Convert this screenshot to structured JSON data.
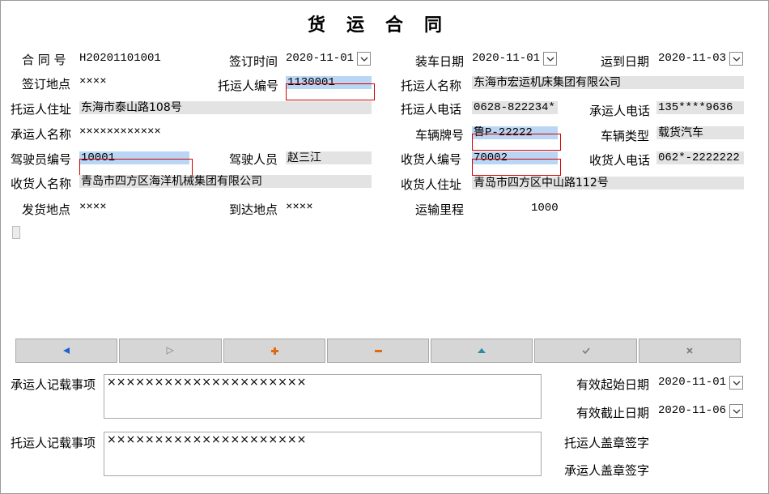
{
  "title": "货运合同",
  "colors": {
    "selection": "#b9d6f5",
    "field_bg": "#e3e3e3",
    "error_border": "#d40000",
    "nav_bg": "#d6d6d6"
  },
  "fields": {
    "contract_no_label": "合 同 号",
    "contract_no": "H20201101001",
    "sign_time_label": "签订时间",
    "sign_time": "2020-11-01",
    "load_date_label": "装车日期",
    "load_date": "2020-11-01",
    "arrive_date_label": "运到日期",
    "arrive_date": "2020-11-03",
    "sign_place_label": "签订地点",
    "sign_place": "××××",
    "shipper_no_label": "托运人编号",
    "shipper_no": "1130001",
    "shipper_name_label": "托运人名称",
    "shipper_name": "东海市宏运机床集团有限公司",
    "shipper_addr_label": "托运人住址",
    "shipper_addr": "东海市泰山路108号",
    "shipper_phone_label": "托运人电话",
    "shipper_phone": "0628-822234*",
    "carrier_phone_label": "承运人电话",
    "carrier_phone": "135****9636",
    "carrier_name_label": "承运人名称",
    "carrier_name": "××××××××××××",
    "plate_label": "车辆牌号",
    "plate": "鲁P-22222",
    "vehicle_type_label": "车辆类型",
    "vehicle_type": "载货汽车",
    "driver_no_label": "驾驶员编号",
    "driver_no": "10001",
    "driver_label": "驾驶人员",
    "driver": "赵三江",
    "consignee_no_label": "收货人编号",
    "consignee_no": "70002",
    "consignee_phone_label": "收货人电话",
    "consignee_phone": "062*-2222222",
    "consignee_name_label": "收货人名称",
    "consignee_name": "青岛市四方区海洋机械集团有限公司",
    "consignee_addr_label": "收货人住址",
    "consignee_addr": "青岛市四方区中山路112号",
    "origin_label": "发货地点",
    "origin": "××××",
    "destination_label": "到达地点",
    "destination": "××××",
    "distance_label": "运输里程",
    "distance": "1000"
  },
  "nav": [
    {
      "name": "nav-prev-button",
      "icon": "triangle-left-icon",
      "color": "#1f5fd0"
    },
    {
      "name": "nav-next-button",
      "icon": "triangle-right-icon",
      "color": "#9a9a9a"
    },
    {
      "name": "nav-add-button",
      "icon": "plus-icon",
      "color": "#e06a10"
    },
    {
      "name": "nav-delete-button",
      "icon": "minus-icon",
      "color": "#e06a10"
    },
    {
      "name": "nav-edit-button",
      "icon": "triangle-up-icon",
      "color": "#2a8aa8"
    },
    {
      "name": "nav-confirm-button",
      "icon": "check-icon",
      "color": "#7a7a7a"
    },
    {
      "name": "nav-cancel-button",
      "icon": "x-icon",
      "color": "#7a7a7a"
    }
  ],
  "bottom": {
    "carrier_notes_label": "承运人记载事项",
    "carrier_notes": "×××××××××××××××××××××",
    "shipper_notes_label": "托运人记载事项",
    "shipper_notes": "×××××××××××××××××××××",
    "valid_start_label": "有效起始日期",
    "valid_start": "2020-11-01",
    "valid_end_label": "有效截止日期",
    "valid_end": "2020-11-06",
    "shipper_seal_label": "托运人盖章签字",
    "carrier_seal_label": "承运人盖章签字"
  }
}
